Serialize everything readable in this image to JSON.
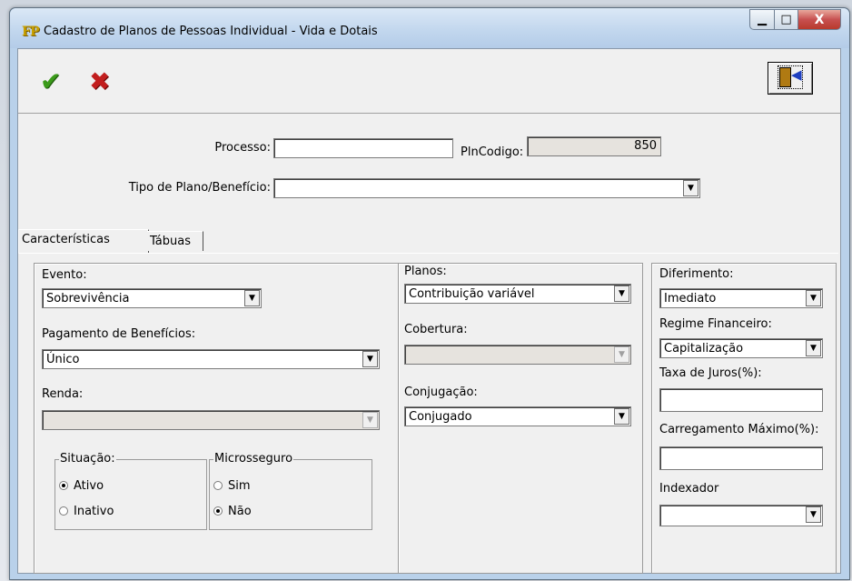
{
  "window": {
    "icon_text": "FP",
    "title": "Cadastro de Planos de Pessoas Individual - Vida e Dotais",
    "min_symbol": "▁",
    "max_symbol": "□",
    "close_symbol": "X"
  },
  "toolbar": {
    "ok_symbol": "✔",
    "cancel_symbol": "✖",
    "exit_symbol": "◀"
  },
  "form": {
    "processo_label": "Processo:",
    "processo_value": "",
    "plncodigo_label": "PlnCodigo:",
    "plncodigo_value": "850",
    "tipo_label": "Tipo de Plano/Benefício:",
    "tipo_value": ""
  },
  "tabs": [
    {
      "label": "Características",
      "active": true
    },
    {
      "label": "Tábuas",
      "active": false
    }
  ],
  "caracteristicas": {
    "evento_label": "Evento:",
    "evento_value": "Sobrevivência",
    "pagamento_label": "Pagamento de Benefícios:",
    "pagamento_value": "Único",
    "renda_label": "Renda:",
    "renda_value": "",
    "situacao": {
      "legend": "Situação:",
      "options": [
        {
          "label": "Ativo",
          "selected": true
        },
        {
          "label": "Inativo",
          "selected": false
        }
      ]
    },
    "microsseguro": {
      "legend": "Microsseguro",
      "options": [
        {
          "label": "Sim",
          "selected": false
        },
        {
          "label": "Não",
          "selected": true
        }
      ]
    },
    "planos_label": "Planos:",
    "planos_value": "Contribuição variável",
    "cobertura_label": "Cobertura:",
    "cobertura_value": "",
    "conjugacao_label": "Conjugação:",
    "conjugacao_value": "Conjugado",
    "diferimento_label": "Diferimento:",
    "diferimento_value": "Imediato",
    "regime_label": "Regime Financeiro:",
    "regime_value": "Capitalização",
    "taxa_label": "Taxa de Juros(%):",
    "taxa_value": "",
    "carregamento_label": "Carregamento Máximo(%):",
    "carregamento_value": "",
    "indexador_label": "Indexador",
    "indexador_value": ""
  },
  "dropdown_arrow": "▼"
}
